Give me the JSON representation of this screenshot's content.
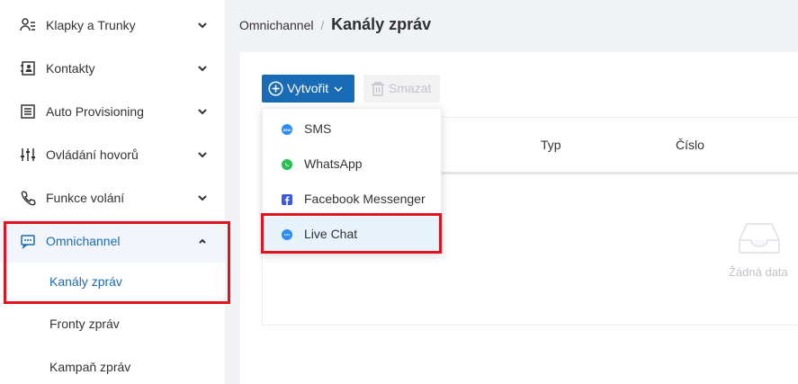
{
  "sidebar": {
    "items": [
      {
        "label": "Klapky a Trunky",
        "icon": "user-list-icon"
      },
      {
        "label": "Kontakty",
        "icon": "contacts-book-icon"
      },
      {
        "label": "Auto Provisioning",
        "icon": "document-stack-icon"
      },
      {
        "label": "Ovládání hovorů",
        "icon": "sliders-icon"
      },
      {
        "label": "Funkce volání",
        "icon": "phone-icon"
      },
      {
        "label": "Omnichannel",
        "icon": "chat-icon"
      }
    ],
    "subitems": [
      {
        "label": "Kanály zpráv"
      },
      {
        "label": "Fronty zpráv"
      },
      {
        "label": "Kampaň zpráv"
      }
    ]
  },
  "breadcrumb": {
    "parent": "Omnichannel",
    "separator": "/",
    "current": "Kanály zpráv"
  },
  "toolbar": {
    "create_label": "Vytvořit",
    "delete_label": "Smazat"
  },
  "table": {
    "columns": [
      "Typ",
      "Číslo"
    ],
    "empty_text": "Žádná data"
  },
  "dropdown": {
    "items": [
      {
        "label": "SMS",
        "icon": "sms-icon",
        "color": "#2d8cf0"
      },
      {
        "label": "WhatsApp",
        "icon": "whatsapp-icon",
        "color": "#25c251"
      },
      {
        "label": "Facebook Messenger",
        "icon": "facebook-icon",
        "color": "#3b5bdb"
      },
      {
        "label": "Live Chat",
        "icon": "live-chat-icon",
        "color": "#2d8cf0"
      }
    ]
  },
  "colors": {
    "accent": "#1a6bb5",
    "highlight": "#e0131f"
  }
}
